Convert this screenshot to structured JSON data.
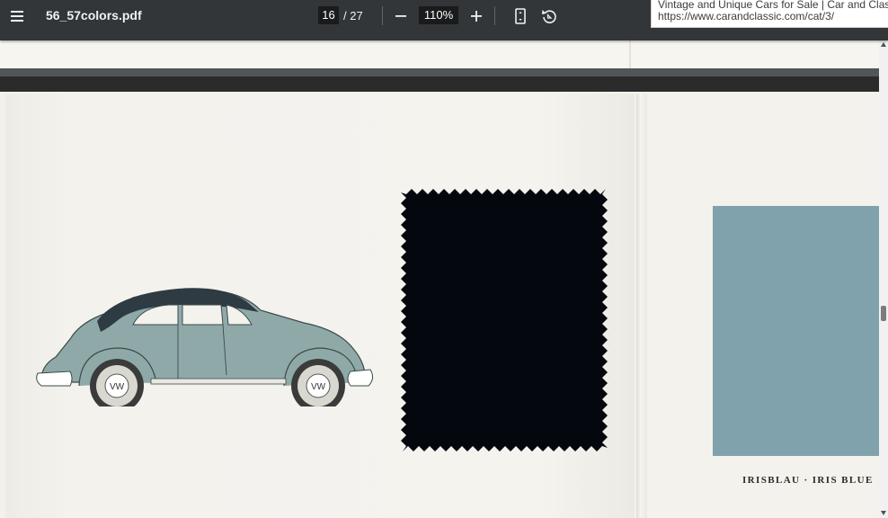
{
  "toolbar": {
    "title": "56_57colors.pdf",
    "page_current": "16",
    "page_total": "/ 27",
    "zoom": "110%",
    "icons": [
      "menu-icon",
      "zoom-out-icon",
      "zoom-in-icon",
      "fit-page-icon",
      "rotate-icon"
    ]
  },
  "tooltip": {
    "line1": "Vintage and Unique Cars for Sale | Car and Classic",
    "line2": "https://www.carandclassic.com/cat/3/"
  },
  "page": {
    "swatch_label": "IRISBLAU · IRIS BLUE",
    "swatch_color": "#7fa2ad",
    "fabric_color": "#05070f",
    "car_body_color": "#8fa9a9",
    "car_roof_color": "#2e3b43"
  }
}
